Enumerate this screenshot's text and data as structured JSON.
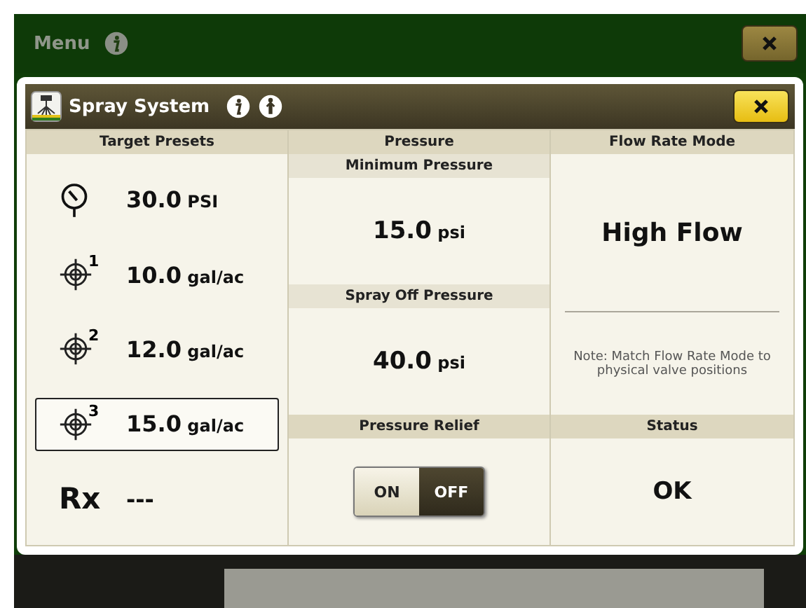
{
  "menu_bar": {
    "title": "Menu"
  },
  "dialog": {
    "title": "Spray System"
  },
  "target_presets": {
    "heading": "Target Presets",
    "items": [
      {
        "kind": "pressure",
        "value": "30.0",
        "unit": "PSI",
        "selected": false
      },
      {
        "kind": "target",
        "badge": "1",
        "value": "10.0",
        "unit": "gal/ac",
        "selected": false
      },
      {
        "kind": "target",
        "badge": "2",
        "value": "12.0",
        "unit": "gal/ac",
        "selected": false
      },
      {
        "kind": "target",
        "badge": "3",
        "value": "15.0",
        "unit": "gal/ac",
        "selected": true
      },
      {
        "kind": "rx",
        "badge": "Rx",
        "value": "---",
        "selected": false
      }
    ]
  },
  "pressure": {
    "heading": "Pressure",
    "sections": [
      {
        "label": "Minimum Pressure",
        "value": "15.0",
        "unit": "psi"
      },
      {
        "label": "Spray Off Pressure",
        "value": "40.0",
        "unit": "psi"
      }
    ],
    "relief": {
      "label": "Pressure Relief",
      "options": [
        {
          "label": "ON",
          "selected": false
        },
        {
          "label": "OFF",
          "selected": true
        }
      ]
    }
  },
  "flow_rate_mode": {
    "heading": "Flow Rate Mode",
    "value": "High Flow",
    "note": "Note: Match Flow Rate Mode to physical valve positions"
  },
  "status": {
    "heading": "Status",
    "value": "OK"
  }
}
